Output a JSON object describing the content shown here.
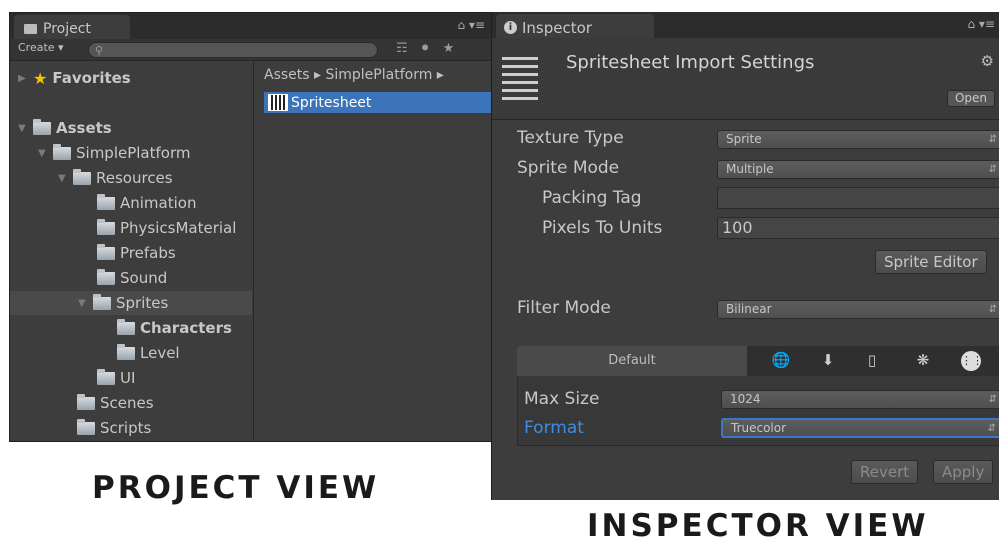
{
  "project": {
    "tab_label": "Project",
    "tab_right": "⌂ ▾≡",
    "create_label": "Create ▾",
    "tree": [
      {
        "label": "Favorites",
        "kind": "favorites"
      },
      {
        "label": "Assets"
      },
      {
        "label": "SimplePlatform"
      },
      {
        "label": "Resources"
      },
      {
        "label": "Animation"
      },
      {
        "label": "PhysicsMaterial"
      },
      {
        "label": "Prefabs"
      },
      {
        "label": "Sound"
      },
      {
        "label": "Sprites"
      },
      {
        "label": "Characters",
        "selected": true
      },
      {
        "label": "Level"
      },
      {
        "label": "UI"
      },
      {
        "label": "Scenes"
      },
      {
        "label": "Scripts"
      }
    ],
    "breadcrumb": "Assets ▸ SimplePlatform ▸",
    "assets": [
      {
        "label": "Spritesheet",
        "selected": true
      }
    ]
  },
  "inspector": {
    "tab_label": "Inspector",
    "tab_right": "⌂ ▾≡",
    "title": "Spritesheet Import Settings",
    "open_label": "Open",
    "fields": {
      "texture_type": {
        "label": "Texture Type",
        "value": "Sprite"
      },
      "sprite_mode": {
        "label": "Sprite Mode",
        "value": "Multiple"
      },
      "packing_tag": {
        "label": "Packing Tag",
        "value": ""
      },
      "pixels_to_units": {
        "label": "Pixels To Units",
        "value": "100"
      },
      "filter_mode": {
        "label": "Filter Mode",
        "value": "Bilinear"
      },
      "max_size": {
        "label": "Max Size",
        "value": "1024"
      },
      "format": {
        "label": "Format",
        "value": "Truecolor"
      }
    },
    "sprite_editor_label": "Sprite Editor",
    "platform_default": "Default",
    "platform_icons": [
      "globe-icon",
      "download-icon",
      "phone-icon",
      "android-icon",
      "blackberry-icon"
    ],
    "revert_label": "Revert",
    "apply_label": "Apply"
  },
  "captions": {
    "project": "PROJECT VIEW",
    "inspector": "INSPECTOR VIEW"
  },
  "colors": {
    "panel_bg": "#3d3d3d",
    "selection_blue": "#3b74b9",
    "format_label_blue": "#3b8ee5"
  }
}
